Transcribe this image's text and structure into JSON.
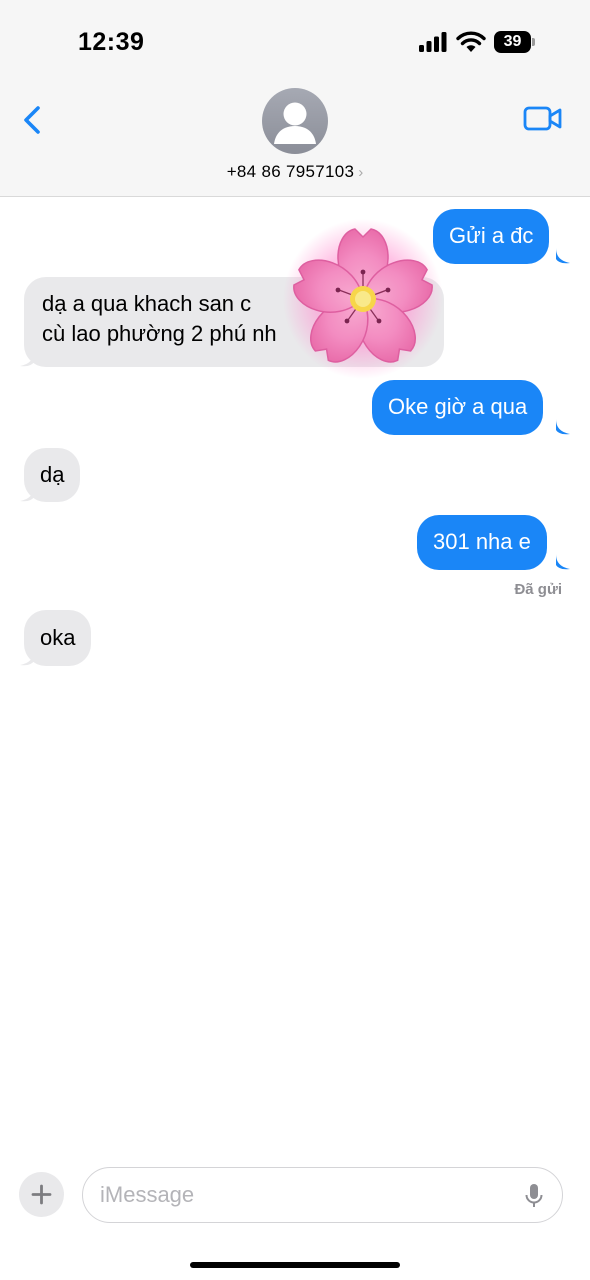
{
  "status_bar": {
    "time": "12:39",
    "battery_level": "39",
    "icons": [
      "signal-icon",
      "wifi-icon",
      "battery-icon"
    ]
  },
  "header": {
    "contact": "+84 86 7957103",
    "chevron": "›",
    "icons": [
      "back-chevron-icon",
      "avatar-icon",
      "video-camera-icon"
    ],
    "accent_color": "#1a86f7"
  },
  "messages": [
    {
      "direction": "outgoing",
      "text": "Gửi a đc"
    },
    {
      "direction": "incoming",
      "text": "dạ a qua khach san c\ncù lao phường 2 phú nh"
    },
    {
      "direction": "outgoing",
      "text": "Oke giờ a qua"
    },
    {
      "direction": "incoming",
      "text": "dạ"
    },
    {
      "direction": "outgoing",
      "text": "301 nha e"
    },
    {
      "direction": "incoming",
      "text": "oka"
    }
  ],
  "delivery_status": "Đã gửi",
  "overlay": {
    "icon": "cherry-blossom-icon"
  },
  "composer": {
    "placeholder": "iMessage",
    "icons": [
      "plus-icon",
      "microphone-icon"
    ]
  },
  "colors": {
    "outgoing_bubble": "#1a86f7",
    "incoming_bubble": "#e9e9eb",
    "background": "#ffffff"
  }
}
